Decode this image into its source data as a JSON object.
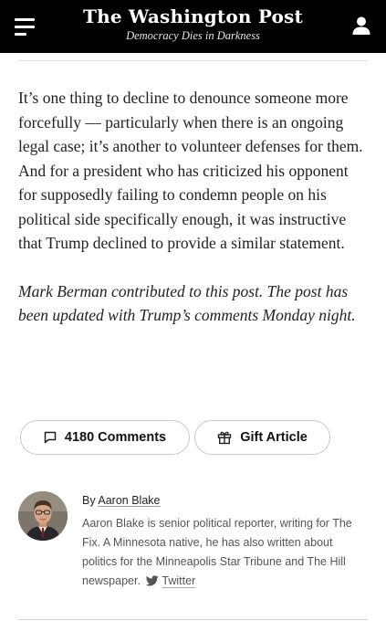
{
  "header": {
    "logo": "The Washington Post",
    "tagline": "Democracy Dies in Darkness",
    "menu_icon": "hamburger-menu-icon",
    "account_icon": "user-account-icon",
    "background": "#000000"
  },
  "article": {
    "paragraphs": [
      "It’s one thing to decline to denounce someone more forcefully — particularly when there is an ongoing legal case; it’s another to volunteer defenses for them. And for a president who has criticized his opponent for supposedly failing to condemn people on his political side specifically enough, it was instructive that Trump declined to provide a similar statement."
    ],
    "contributor_note": "Mark Berman contributed to this post. The post has been updated with Trump’s comments Monday night."
  },
  "actions": {
    "comments_label": "4180 Comments",
    "comments_icon": "comment-bubble-icon",
    "gift_label": "Gift Article",
    "gift_icon": "gift-icon"
  },
  "author": {
    "by_prefix": "By",
    "name": "Aaron Blake",
    "bio": "Aaron Blake is senior political reporter, writing for The Fix. A Minnesota native, he has also written about politics for the Minneapolis Star Tribune and The Hill newspaper.",
    "twitter_label": "Twitter",
    "twitter_icon": "twitter-bird-icon",
    "twitter_color": "#555555"
  }
}
